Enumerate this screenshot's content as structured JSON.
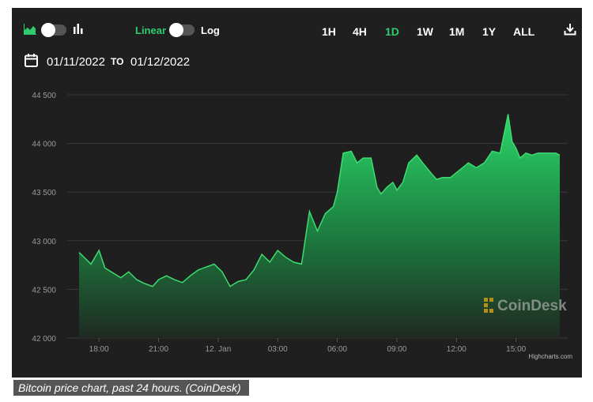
{
  "toolbar": {
    "scale_linear_label": "Linear",
    "scale_log_label": "Log",
    "ranges": [
      "1H",
      "4H",
      "1D",
      "1W",
      "1M",
      "1Y",
      "ALL"
    ],
    "active_range": "1D",
    "download_icon": "download-icon",
    "area_chart_icon": "area-chart-icon",
    "bar_chart_icon": "bar-chart-icon"
  },
  "date_range": {
    "from": "01/11/2022",
    "separator": "TO",
    "to": "01/12/2022",
    "icon": "calendar-icon"
  },
  "watermark": "CoinDesk",
  "credits": "Highcharts.com",
  "caption": "Bitcoin price chart, past 24 hours. (CoinDesk)",
  "colors": {
    "accent": "#2ecc71",
    "background": "#1f1f1f",
    "line": "#3ddc6f"
  },
  "chart_data": {
    "type": "area",
    "title": "",
    "xlabel": "",
    "ylabel": "",
    "ylim": [
      42000,
      44500
    ],
    "y_ticks": [
      42000,
      42500,
      43000,
      43500,
      44000,
      44500
    ],
    "y_tick_labels": [
      "42 000",
      "42 500",
      "43 000",
      "43 500",
      "44 000",
      "44 500"
    ],
    "x_tick_labels": [
      "18:00",
      "21:00",
      "12. Jan",
      "03:00",
      "06:00",
      "09:00",
      "12:00",
      "15:00"
    ],
    "x_tick_hours": [
      18,
      21,
      24,
      27,
      30,
      33,
      36,
      39
    ],
    "grid": true,
    "series": [
      {
        "x_hours": [
          17.0,
          17.3,
          17.6,
          18.0,
          18.3,
          18.7,
          19.1,
          19.5,
          19.9,
          20.3,
          20.7,
          21.0,
          21.4,
          21.8,
          22.2,
          22.6,
          23.0,
          23.4,
          23.8,
          24.2,
          24.6,
          25.0,
          25.4,
          25.8,
          26.2,
          26.6,
          27.0,
          27.4,
          27.8,
          28.2,
          28.6,
          29.0,
          29.4,
          29.8,
          30.0,
          30.3,
          30.7,
          31.0,
          31.3,
          31.7,
          32.0,
          32.2,
          32.5,
          32.8,
          33.0,
          33.3,
          33.6,
          34.0,
          34.3,
          34.7,
          35.0,
          35.3,
          35.7,
          36.0,
          36.3,
          36.6,
          37.0,
          37.4,
          37.8,
          38.2,
          38.6,
          38.8,
          39.0,
          39.2,
          39.5,
          39.8,
          40.1,
          40.4,
          40.7,
          41.0,
          41.2
        ],
        "values": [
          42880,
          42820,
          42760,
          42900,
          42720,
          42670,
          42620,
          42680,
          42600,
          42560,
          42530,
          42600,
          42640,
          42600,
          42570,
          42640,
          42700,
          42730,
          42760,
          42680,
          42530,
          42580,
          42600,
          42700,
          42860,
          42780,
          42900,
          42830,
          42780,
          42760,
          43300,
          43100,
          43280,
          43350,
          43500,
          43900,
          43920,
          43800,
          43850,
          43850,
          43550,
          43480,
          43550,
          43600,
          43520,
          43600,
          43800,
          43880,
          43800,
          43700,
          43630,
          43650,
          43650,
          43700,
          43750,
          43800,
          43750,
          43800,
          43920,
          43900,
          44300,
          44020,
          43950,
          43850,
          43900,
          43880,
          43900,
          43900,
          43900,
          43900,
          43880
        ]
      }
    ]
  }
}
